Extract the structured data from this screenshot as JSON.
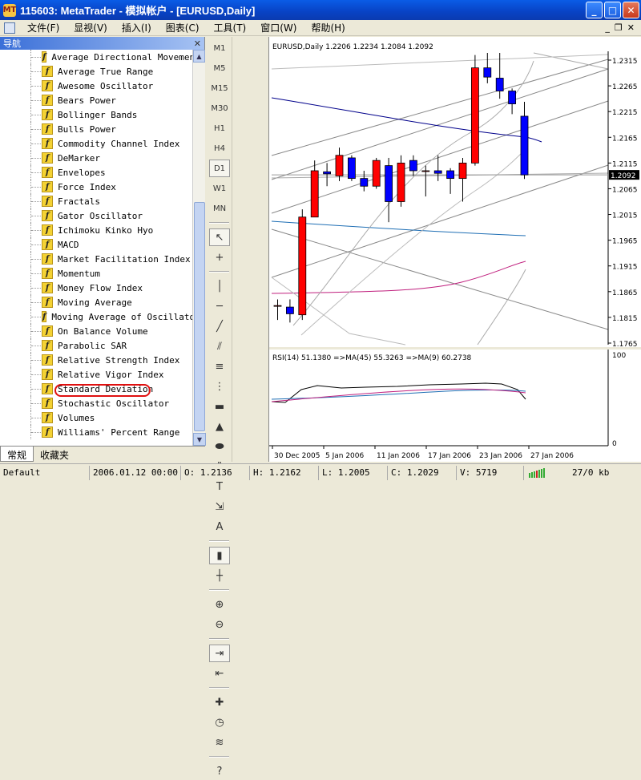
{
  "window": {
    "title": "115603: MetaTrader - 模拟帐户 - [EURUSD,Daily]",
    "app_icon": "MT"
  },
  "menu": [
    "文件(F)",
    "显视(V)",
    "插入(I)",
    "图表(C)",
    "工具(T)",
    "窗口(W)",
    "帮助(H)"
  ],
  "navigator": {
    "title": "导航",
    "items": [
      "Average Directional Movement",
      "Average True Range",
      "Awesome Oscillator",
      "Bears Power",
      "Bollinger Bands",
      "Bulls Power",
      "Commodity Channel Index",
      "DeMarker",
      "Envelopes",
      "Force Index",
      "Fractals",
      "Gator Oscillator",
      "Ichimoku Kinko Hyo",
      "MACD",
      "Market Facilitation Index",
      "Momentum",
      "Money Flow Index",
      "Moving Average",
      "Moving Average of Oscillator",
      "On Balance Volume",
      "Parabolic SAR",
      "Relative Strength Index",
      "Relative Vigor Index",
      "Standard Deviation",
      "Stochastic Oscillator",
      "Volumes",
      "Williams' Percent Range"
    ],
    "highlighted": "Standard Deviation",
    "tabs": [
      "常规",
      "收藏夹"
    ]
  },
  "timeframes": [
    "M1",
    "M5",
    "M15",
    "M30",
    "H1",
    "H4",
    "D1",
    "W1",
    "MN"
  ],
  "active_timeframe": "D1",
  "chart_data": {
    "type": "candlestick",
    "header": "EURUSD,Daily  1.2206 1.2234 1.2084 1.2092",
    "price_labels": [
      "1.2315",
      "1.2265",
      "1.2215",
      "1.2165",
      "1.2115",
      "1.2065",
      "1.2015",
      "1.1965",
      "1.1915",
      "1.1865",
      "1.1815",
      "1.1765"
    ],
    "ylim": [
      1.1765,
      1.2315
    ],
    "current_price": "1.2092",
    "x_labels": [
      "30 Dec 2005",
      "5 Jan 2006",
      "11 Jan 2006",
      "17 Jan 2006",
      "23 Jan 2006",
      "27 Jan 2006"
    ],
    "candles": [
      {
        "o": 1.1838,
        "h": 1.185,
        "l": 1.181,
        "c": 1.1838
      },
      {
        "o": 1.1835,
        "h": 1.185,
        "l": 1.1805,
        "c": 1.1822
      },
      {
        "o": 1.182,
        "h": 1.2025,
        "l": 1.181,
        "c": 1.201
      },
      {
        "o": 1.201,
        "h": 1.212,
        "l": 1.201,
        "c": 1.21
      },
      {
        "o": 1.2098,
        "h": 1.2115,
        "l": 1.207,
        "c": 1.2094
      },
      {
        "o": 1.209,
        "h": 1.2145,
        "l": 1.208,
        "c": 1.213
      },
      {
        "o": 1.2125,
        "h": 1.213,
        "l": 1.208,
        "c": 1.2085
      },
      {
        "o": 1.2085,
        "h": 1.21,
        "l": 1.206,
        "c": 1.207
      },
      {
        "o": 1.207,
        "h": 1.2125,
        "l": 1.2065,
        "c": 1.212
      },
      {
        "o": 1.211,
        "h": 1.2125,
        "l": 1.2,
        "c": 1.204
      },
      {
        "o": 1.204,
        "h": 1.213,
        "l": 1.203,
        "c": 1.2115
      },
      {
        "o": 1.212,
        "h": 1.213,
        "l": 1.209,
        "c": 1.21
      },
      {
        "o": 1.21,
        "h": 1.211,
        "l": 1.205,
        "c": 1.21
      },
      {
        "o": 1.21,
        "h": 1.213,
        "l": 1.208,
        "c": 1.2095
      },
      {
        "o": 1.21,
        "h": 1.2105,
        "l": 1.2055,
        "c": 1.2085
      },
      {
        "o": 1.2085,
        "h": 1.2125,
        "l": 1.204,
        "c": 1.2115
      },
      {
        "o": 1.2115,
        "h": 1.2325,
        "l": 1.211,
        "c": 1.23
      },
      {
        "o": 1.23,
        "h": 1.2335,
        "l": 1.227,
        "c": 1.2282
      },
      {
        "o": 1.228,
        "h": 1.2335,
        "l": 1.224,
        "c": 1.2255
      },
      {
        "o": 1.2255,
        "h": 1.226,
        "l": 1.221,
        "c": 1.223
      },
      {
        "o": 1.2206,
        "h": 1.2234,
        "l": 1.2084,
        "c": 1.2092
      }
    ],
    "rsi": {
      "header": "RSI(14) 51.1380 =>MA(45) 55.3263 =>MA(9) 60.2738",
      "max_label": "100",
      "min_label": "0"
    }
  },
  "status": {
    "profile": "Default",
    "datetime": "2006.01.12 00:00",
    "open": "O: 1.2136",
    "high": "H: 1.2162",
    "low": "L: 1.2005",
    "close": "C: 1.2029",
    "volume": "V: 5719",
    "traffic": "27/0 kb"
  },
  "colors": {
    "bull": "#ff0000",
    "bear": "#0000ff",
    "title_bar": "#0842c4",
    "highlight": "#e01010"
  }
}
